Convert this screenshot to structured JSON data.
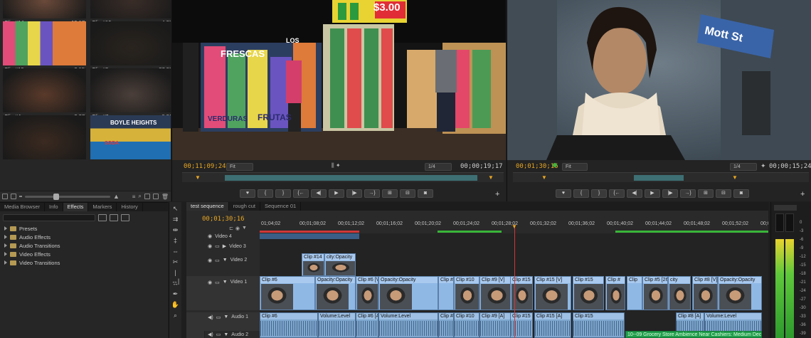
{
  "bin": {
    "clips": [
      {
        "name": "Clip #14",
        "duration": "19;17",
        "col": 0,
        "row": 0,
        "tone": "#6b4a3a"
      },
      {
        "name": "Clip #15",
        "duration": "4;27",
        "col": 1,
        "row": 0,
        "tone": "#3a2d28"
      },
      {
        "name": "Clip #19",
        "duration": "2;15",
        "col": 0,
        "row": 1,
        "tone": "#8a4a5a"
      },
      {
        "name": "Clip #3",
        "duration": "37;08",
        "col": 1,
        "row": 1,
        "tone": "#2a241e"
      },
      {
        "name": "Clip #4",
        "duration": "2;27",
        "col": 0,
        "row": 2,
        "tone": "#5a3a2a"
      },
      {
        "name": "Clip #7",
        "duration": "6;01",
        "col": 1,
        "row": 2,
        "tone": "#4b3f3a"
      },
      {
        "name": "",
        "duration": "",
        "col": 0,
        "row": 3,
        "tone": "#3b2a20"
      },
      {
        "name": "",
        "duration": "",
        "col": 1,
        "row": 3,
        "tone": "#4a5a6a"
      }
    ],
    "sign_text": "BOYLE HEIGHTS",
    "sign_text2": "SODA"
  },
  "source_monitor": {
    "timecode_left": "00;11;09;24",
    "zoom": "Fit",
    "resolution": "1/4",
    "timecode_right": "00;00;19;17",
    "price_sign": "$3.00",
    "banner_text": "FRESCAS",
    "banner_text2": "LOS",
    "floor_text": "VERDURAS",
    "floor_text2": "FRUTAS"
  },
  "program_monitor": {
    "timecode_left": "00;01;30;16",
    "zoom": "Fit",
    "resolution": "1/4",
    "timecode_right": "00;00;15;24",
    "street_sign": "Mott St"
  },
  "effects_panel": {
    "tabs": [
      "Media Browser",
      "Info",
      "Effects",
      "Markers",
      "History"
    ],
    "active_tab": "Effects",
    "items": [
      "Presets",
      "Audio Effects",
      "Audio Transitions",
      "Video Effects",
      "Video Transitions"
    ]
  },
  "timeline": {
    "tabs": [
      "test sequence",
      "rough cut",
      "Sequence 01"
    ],
    "active_tab": "test sequence",
    "playhead_timecode": "00;01;30;16",
    "ruler_labels": [
      "01;04;02",
      "00;01;08;02",
      "00;01;12;02",
      "00;01;16;02",
      "00;01;20;02",
      "00;01;24;02",
      "00;01;28;02",
      "00;01;32;02",
      "00;01;36;02",
      "00;01;40;02",
      "00;01;44;02",
      "00;01;48;02",
      "00;01;52;02",
      "00;01;5"
    ],
    "tracks": {
      "video4": "Video 4",
      "video3": "Video 3",
      "video2": "Video 2",
      "video1": "Video 1",
      "audio1": "Audio 1",
      "audio2": "Audio 2",
      "v_target": "V",
      "a_target": "A1"
    },
    "video2_clips": [
      {
        "label": "Clip #14",
        "start": 59,
        "width": 32
      },
      {
        "label": "city:Opacity",
        "start": 91,
        "width": 44
      }
    ],
    "video1_clips": [
      {
        "label": "Clip #6",
        "start": 0,
        "width": 78
      },
      {
        "label": "Opacity:Opacity",
        "start": 78,
        "width": 57
      },
      {
        "label": "Clip #6 [V]",
        "start": 135,
        "width": 32
      },
      {
        "label": "Opacity:Opacity",
        "start": 167,
        "width": 84
      },
      {
        "label": "Clip #",
        "start": 251,
        "width": 22
      },
      {
        "label": "Clip #10",
        "start": 273,
        "width": 36
      },
      {
        "label": "Clip #9 [V]",
        "start": 309,
        "width": 50
      },
      {
        "label": "Clip #15",
        "start": 352,
        "width": 32
      },
      {
        "label": "Clip #15 [V]",
        "start": 386,
        "width": 52
      },
      {
        "label": "Clip #15",
        "start": 440,
        "width": 44
      },
      {
        "label": "Clip #",
        "start": 486,
        "width": 28
      },
      {
        "label": "Clip",
        "start": 516,
        "width": 22
      },
      {
        "label": "Clip #5 [264%]",
        "start": 538,
        "width": 36
      },
      {
        "label": "city",
        "start": 574,
        "width": 32
      },
      {
        "label": "Clip #8 [V]",
        "start": 608,
        "width": 36
      },
      {
        "label": "Opacity:Opacity",
        "start": 644,
        "width": 62
      }
    ],
    "audio1_clips": [
      {
        "label": "Clip #6",
        "start": 0,
        "width": 82
      },
      {
        "label": "Volume:Level",
        "start": 82,
        "width": 53
      },
      {
        "label": "Clip #6 [A]",
        "start": 135,
        "width": 32
      },
      {
        "label": "Volume:Level",
        "start": 167,
        "width": 84
      },
      {
        "label": "Clip #",
        "start": 251,
        "width": 22
      },
      {
        "label": "Clip #10",
        "start": 273,
        "width": 36
      },
      {
        "label": "Clip #9 [A]",
        "start": 309,
        "width": 50
      },
      {
        "label": "Clip #15",
        "start": 352,
        "width": 32
      },
      {
        "label": "Clip #15 [A]",
        "start": 386,
        "width": 52
      },
      {
        "label": "Clip #15",
        "start": 440,
        "width": 73
      },
      {
        "label": "Clip #8 [A]",
        "start": 585,
        "width": 40
      },
      {
        "label": "Volume:Level",
        "start": 625,
        "width": 81
      }
    ],
    "audio2_clips": [
      {
        "label": "Clip #6",
        "start": 0,
        "width": 82
      },
      {
        "label": "Volume:Level",
        "start": 82,
        "width": 53
      }
    ],
    "green_clip": {
      "label": "10--09 Grocery Store Ambience Near Cashiers: Medium Dect",
      "start": 514,
      "width": 192
    }
  },
  "meters": {
    "scale": [
      "0",
      "-3",
      "-6",
      "-9",
      "-12",
      "-15",
      "-18",
      "-21",
      "-24",
      "-27",
      "-30",
      "-33",
      "-36",
      "-39"
    ]
  }
}
